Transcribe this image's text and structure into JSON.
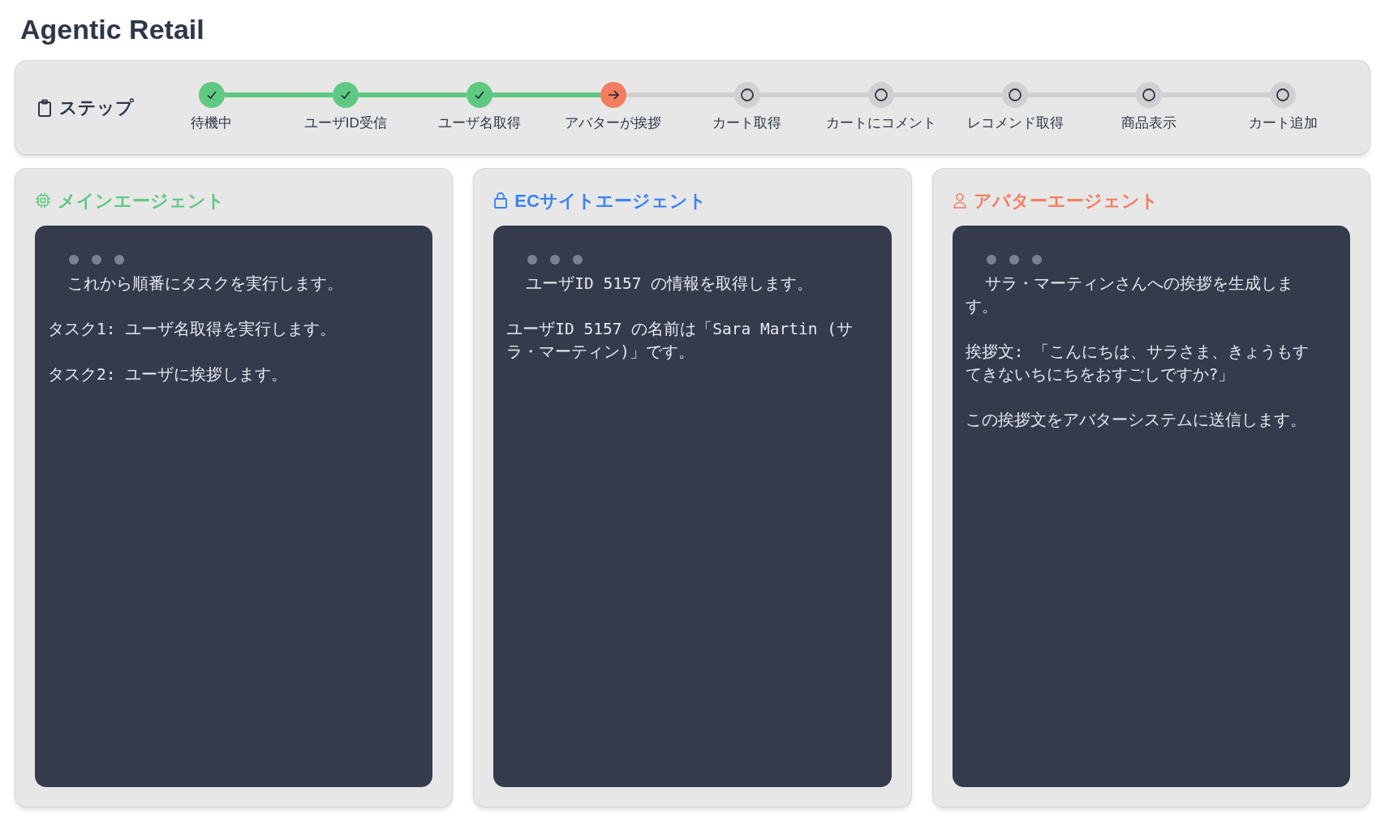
{
  "title": "Agentic Retail",
  "stepper": {
    "label": "ステップ",
    "steps": [
      {
        "label": "待機中",
        "kind": "done"
      },
      {
        "label": "ユーザID受信",
        "kind": "done"
      },
      {
        "label": "ユーザ名取得",
        "kind": "done"
      },
      {
        "label": "アバターが挨拶",
        "kind": "current"
      },
      {
        "label": "カート取得",
        "kind": "pending"
      },
      {
        "label": "カートにコメント",
        "kind": "pending"
      },
      {
        "label": "レコメンド取得",
        "kind": "pending"
      },
      {
        "label": "商品表示",
        "kind": "pending"
      },
      {
        "label": "カート追加",
        "kind": "pending"
      }
    ]
  },
  "panels": [
    {
      "title": "メインエージェント",
      "color": "#5fc982",
      "messages": [
        "これから順番にタスクを実行します。",
        "タスク1: ユーザ名取得を実行します。",
        "タスク2: ユーザに挨拶します。"
      ]
    },
    {
      "title": "ECサイトエージェント",
      "color": "#3b82f6",
      "messages": [
        "ユーザID 5157 の情報を取得します。",
        "ユーザID 5157 の名前は「Sara Martin (サラ・マーティン)」です。"
      ]
    },
    {
      "title": "アバターエージェント",
      "color": "#f47c5f",
      "messages": [
        "サラ・マーティンさんへの挨拶を生成します。",
        "挨拶文: 「こんにちは、サラさま、きょうもすてきないちにちをおすごしですか?」",
        "この挨拶文をアバターシステムに送信します。"
      ]
    }
  ]
}
